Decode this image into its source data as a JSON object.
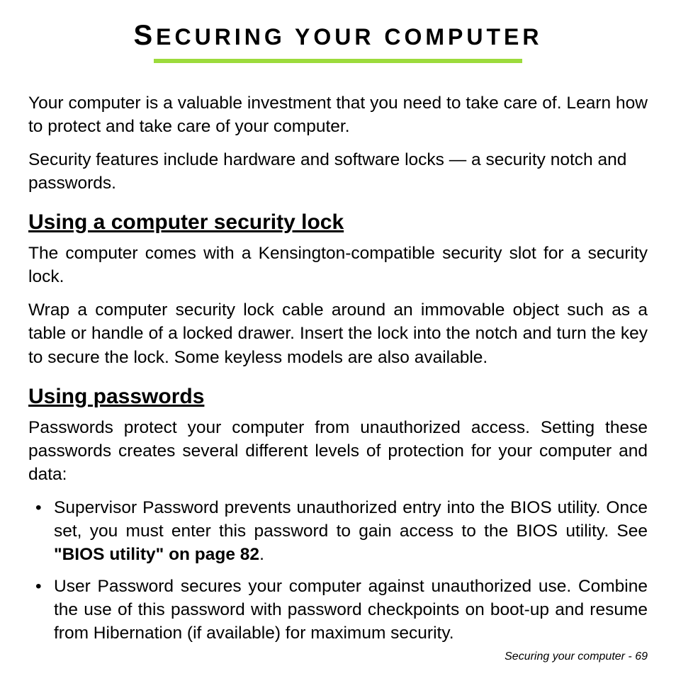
{
  "title": {
    "cap1": "S",
    "rest1": "ECURING",
    "rest2": " YOUR COMPUTER"
  },
  "intro": {
    "p1": "Your computer is a valuable investment that you need to take care of. Learn how to protect and take care of your computer.",
    "p2": "Security features include hardware and software locks — a security notch and passwords."
  },
  "section1": {
    "heading": "Using a computer security lock",
    "p1": "The computer comes with a Kensington-compatible security slot for a security lock.",
    "p2": "Wrap a computer security lock cable around an immovable object such as a table or handle of a locked drawer. Insert the lock into the notch and turn the key to secure the lock. Some keyless models are also available."
  },
  "section2": {
    "heading": "Using passwords",
    "p1": "Passwords protect your computer from unauthorized access. Setting these passwords creates several different levels of protection for your computer and data:",
    "bullets": {
      "b1_pre": "Supervisor Password prevents unauthorized entry into the BIOS utility. Once set, you must enter this password to gain access to the BIOS utility. See ",
      "b1_bold": "\"BIOS utility\" on page 82",
      "b1_post": ".",
      "b2": "User Password secures your computer against unauthorized use. Combine the use of this password with password checkpoints on boot-up and resume from Hibernation (if available) for maximum security."
    }
  },
  "footer": {
    "text": "Securing your computer -  ",
    "page": "69"
  }
}
